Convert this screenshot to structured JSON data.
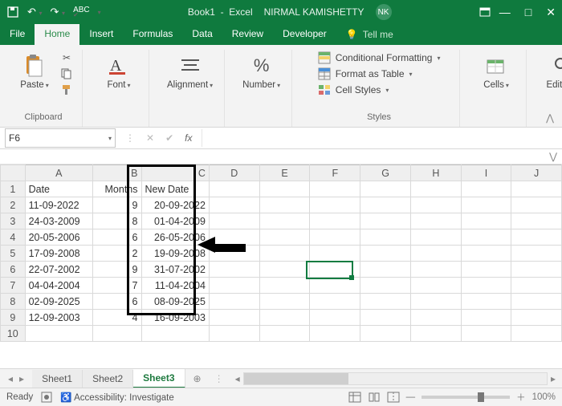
{
  "title": {
    "doc": "Book1",
    "app": "Excel",
    "user": "NIRMAL KAMISHETTY",
    "initials": "NK"
  },
  "tabs": {
    "file": "File",
    "home": "Home",
    "insert": "Insert",
    "formulas": "Formulas",
    "data": "Data",
    "review": "Review",
    "developer": "Developer",
    "tellme": "Tell me"
  },
  "ribbon": {
    "paste": "Paste",
    "clipboard": "Clipboard",
    "font": "Font",
    "alignment": "Alignment",
    "number": "Number",
    "cond": "Conditional Formatting",
    "table": "Format as Table",
    "cellstyles": "Cell Styles",
    "styles": "Styles",
    "cells": "Cells",
    "editing": "Editing"
  },
  "namebox": "F6",
  "sheets": {
    "s1": "Sheet1",
    "s2": "Sheet2",
    "s3": "Sheet3"
  },
  "status": {
    "ready": "Ready",
    "acc": "Accessibility: Investigate",
    "zoom": "100%"
  },
  "cols": [
    "A",
    "B",
    "C",
    "D",
    "E",
    "F",
    "G",
    "H",
    "I",
    "J"
  ],
  "headers": {
    "A": "Date",
    "B": "Months",
    "C": "New Date"
  },
  "rows": [
    {
      "A": "11-09-2022",
      "B": "9",
      "C": "20-09-2022"
    },
    {
      "A": "24-03-2009",
      "B": "8",
      "C": "01-04-2009"
    },
    {
      "A": "20-05-2006",
      "B": "6",
      "C": "26-05-2006"
    },
    {
      "A": "17-09-2008",
      "B": "2",
      "C": "19-09-2008"
    },
    {
      "A": "22-07-2002",
      "B": "9",
      "C": "31-07-2002"
    },
    {
      "A": "04-04-2004",
      "B": "7",
      "C": "11-04-2004"
    },
    {
      "A": "02-09-2025",
      "B": "6",
      "C": "08-09-2025"
    },
    {
      "A": "12-09-2003",
      "B": "4",
      "C": "16-09-2003"
    }
  ]
}
